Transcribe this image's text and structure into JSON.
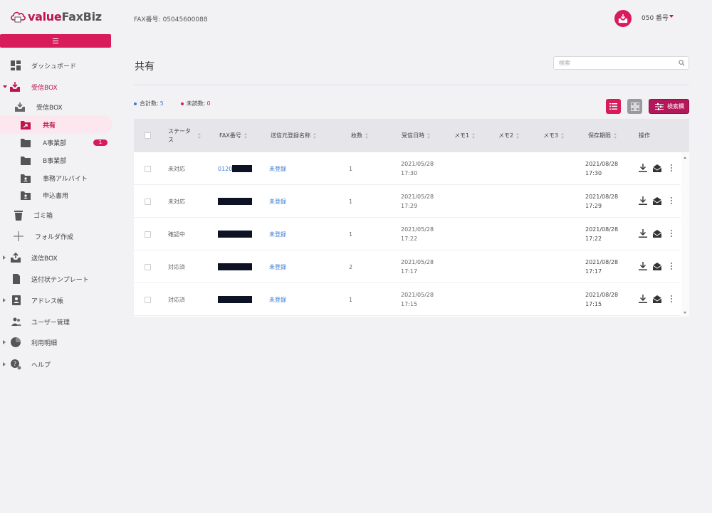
{
  "app": {
    "logo_value": "value",
    "logo_faxbiz": "FaxBiz",
    "menu_icon": "menu-icon",
    "fax_number": "FAX番号: 05045600088",
    "account_label": "050 番号"
  },
  "sidebar": {
    "items": [
      {
        "label": "ダッシュボード",
        "icon": "dashboard-icon"
      },
      {
        "label": "受信BOX",
        "icon": "inbox-icon"
      },
      {
        "label": "受信BOX",
        "icon": "inbox-sub-icon"
      },
      {
        "label": "共有",
        "icon": "share-folder-icon"
      },
      {
        "label": "A事業部",
        "icon": "folder-icon",
        "badge": "1"
      },
      {
        "label": "B事業部",
        "icon": "folder-icon"
      },
      {
        "label": "事務アルバイト",
        "icon": "user-folder-icon"
      },
      {
        "label": "申込書用",
        "icon": "user-folder-icon"
      },
      {
        "label": "ゴミ箱",
        "icon": "trash-icon"
      },
      {
        "label": "フォルダ作成",
        "icon": "plus-icon"
      },
      {
        "label": "送信BOX",
        "icon": "outbox-icon"
      },
      {
        "label": "送付状テンプレート",
        "icon": "document-icon"
      },
      {
        "label": "アドレス帳",
        "icon": "address-book-icon"
      },
      {
        "label": "ユーザー管理",
        "icon": "users-icon"
      },
      {
        "label": "利用明細",
        "icon": "pie-chart-icon"
      },
      {
        "label": "ヘルプ",
        "icon": "help-icon"
      }
    ]
  },
  "main": {
    "title": "共有",
    "search_placeholder": "検索",
    "total_label": "合計数:",
    "total_value": "5",
    "unread_label": "未読数:",
    "unread_value": "0",
    "filter_label": "検索欄",
    "colors": {
      "accent": "#d81b5a",
      "link": "#3a7bd5"
    }
  },
  "table": {
    "headers": [
      "ステータス",
      "FAX番号",
      "送信元登録名称",
      "枚数",
      "受信日時",
      "メモ1",
      "メモ2",
      "メモ3",
      "保存期限",
      "操作"
    ],
    "rows": [
      {
        "status": "未対応",
        "fax": "0120",
        "sender": "未登録",
        "pages": "1",
        "received_date": "2021/05/28",
        "received_time": "17:30",
        "expire_date": "2021/08/28",
        "expire_time": "17:30"
      },
      {
        "status": "未対応",
        "fax": "",
        "sender": "未登録",
        "pages": "1",
        "received_date": "2021/05/28",
        "received_time": "17:29",
        "expire_date": "2021/08/28",
        "expire_time": "17:29"
      },
      {
        "status": "確認中",
        "fax": "",
        "sender": "未登録",
        "pages": "1",
        "received_date": "2021/05/28",
        "received_time": "17:22",
        "expire_date": "2021/08/28",
        "expire_time": "17:22"
      },
      {
        "status": "対応済",
        "fax": "",
        "sender": "未登録",
        "pages": "2",
        "received_date": "2021/05/28",
        "received_time": "17:17",
        "expire_date": "2021/08/28",
        "expire_time": "17:17"
      },
      {
        "status": "対応済",
        "fax": "",
        "sender": "未登録",
        "pages": "1",
        "received_date": "2021/05/28",
        "received_time": "17:15",
        "expire_date": "2021/08/28",
        "expire_time": "17:15"
      }
    ]
  }
}
